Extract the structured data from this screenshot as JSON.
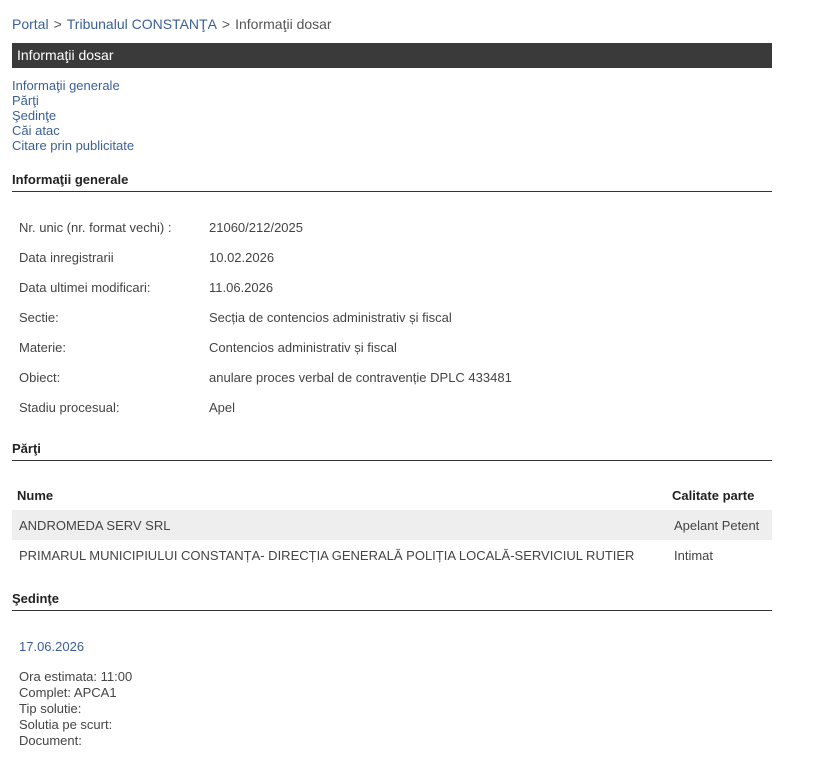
{
  "breadcrumb": {
    "items": [
      "Portal",
      "Tribunalul CONSTANŢA"
    ],
    "current": "Informaţii dosar",
    "separator": ">"
  },
  "title": "Informaţii dosar",
  "nav": [
    "Informaţii generale",
    "Părţi",
    "Şedinţe",
    "Căi atac",
    "Citare prin publicitate"
  ],
  "general": {
    "heading": "Informaţii generale",
    "rows": [
      {
        "label": "Nr. unic (nr. format vechi) :",
        "value": "21060/212/2025"
      },
      {
        "label": "Data inregistrarii",
        "value": "10.02.2026"
      },
      {
        "label": "Data ultimei modificari:",
        "value": "11.06.2026"
      },
      {
        "label": "Sectie:",
        "value": "Secția de contencios administrativ și fiscal"
      },
      {
        "label": "Materie:",
        "value": "Contencios administrativ și fiscal"
      },
      {
        "label": "Obiect:",
        "value": "anulare proces verbal de contravenție DPLC 433481"
      },
      {
        "label": "Stadiu procesual:",
        "value": "Apel"
      }
    ]
  },
  "parti": {
    "heading": "Părţi",
    "columns": [
      "Nume",
      "Calitate parte"
    ],
    "rows": [
      {
        "name": "ANDROMEDA SERV SRL",
        "role": "Apelant Petent"
      },
      {
        "name": "PRIMARUL MUNICIPIULUI CONSTANȚA- DIRECȚIA GENERALĂ POLIȚIA LOCALĂ-SERVICIUL RUTIER",
        "role": "Intimat"
      }
    ]
  },
  "sedinte": {
    "heading": "Şedinţe",
    "date": "17.06.2026",
    "details": [
      "Ora estimata: 11:00",
      "Complet: APCA1",
      "Tip solutie:",
      "Solutia pe scurt:",
      "Document:"
    ]
  },
  "colors": {
    "link": "#3a5f9c",
    "title_bar": "#3a3a3a",
    "row_shade": "#eeeeee"
  }
}
